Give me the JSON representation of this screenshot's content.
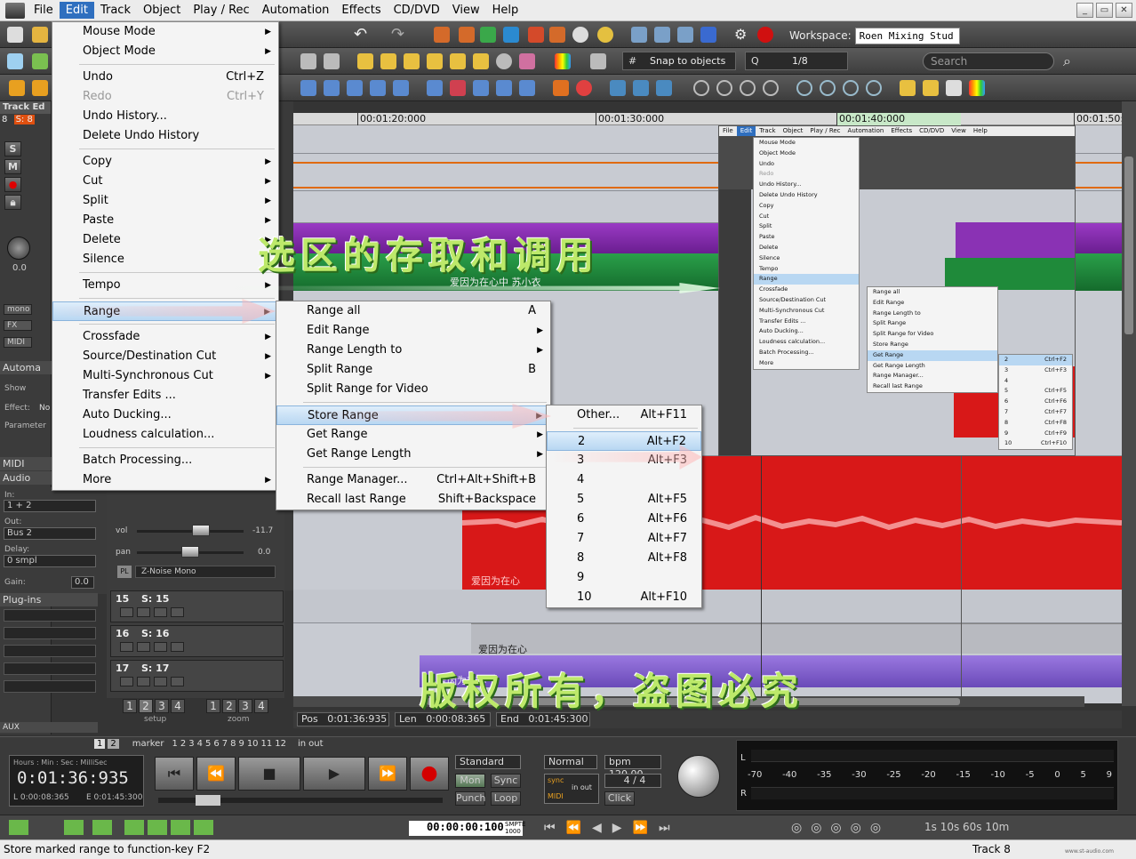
{
  "menubar": {
    "items": [
      "File",
      "Edit",
      "Track",
      "Object",
      "Play / Rec",
      "Automation",
      "Effects",
      "CD/DVD",
      "View",
      "Help"
    ],
    "active": "Edit"
  },
  "toolbar": {
    "workspace_label": "Workspace:",
    "workspace_value": "Roen Mixing Stud",
    "snap": "Snap to objects",
    "quantize": "1/8",
    "search_placeholder": "Search"
  },
  "left_panel": {
    "track_label": "Track Ed",
    "track_number": "8",
    "track_name": "S: 8",
    "pan_value": "0.0",
    "mono_label": "mono",
    "fx_label": "FX",
    "midi_label": "MIDI",
    "automation_header": "Automa",
    "show_label": "Show",
    "effect_label": "Effect:",
    "effect_value": "No",
    "parameter_label": "Parameter",
    "midi_header": "MIDI",
    "audio_header": "Audio",
    "in_label": "In:",
    "in_value": "1 + 2",
    "out_label": "Out:",
    "out_value": "Bus 2",
    "delay_label": "Delay:",
    "delay_value": "0 smpl",
    "gain_label": "Gain:",
    "gain_value": "0.0",
    "plugins_header": "Plug-ins",
    "aux_header": "AUX"
  },
  "edit_menu": {
    "items": [
      {
        "label": "Mouse Mode",
        "shortcut": "",
        "submenu": true
      },
      {
        "label": "Object Mode",
        "shortcut": "",
        "submenu": true
      },
      {
        "sep": true
      },
      {
        "label": "Undo",
        "shortcut": "Ctrl+Z"
      },
      {
        "label": "Redo",
        "shortcut": "Ctrl+Y",
        "disabled": true
      },
      {
        "label": "Undo History...",
        "shortcut": ""
      },
      {
        "label": "Delete Undo History",
        "shortcut": ""
      },
      {
        "sep": true
      },
      {
        "label": "Copy",
        "shortcut": "",
        "submenu": true
      },
      {
        "label": "Cut",
        "shortcut": "",
        "submenu": true
      },
      {
        "label": "Split",
        "shortcut": "",
        "submenu": true
      },
      {
        "label": "Paste",
        "shortcut": "",
        "submenu": true
      },
      {
        "label": "Delete",
        "shortcut": "",
        "submenu": true
      },
      {
        "label": "Silence",
        "shortcut": ""
      },
      {
        "sep": true
      },
      {
        "label": "Tempo",
        "shortcut": "",
        "submenu": true
      },
      {
        "sep": true
      },
      {
        "label": "Range",
        "shortcut": "",
        "submenu": true,
        "highlight": true
      },
      {
        "sep": true
      },
      {
        "label": "Crossfade",
        "shortcut": "",
        "submenu": true
      },
      {
        "label": "Source/Destination Cut",
        "shortcut": "",
        "submenu": true
      },
      {
        "label": "Multi-Synchronous Cut",
        "shortcut": "",
        "submenu": true
      },
      {
        "label": "Transfer Edits ...",
        "shortcut": ""
      },
      {
        "label": "Auto Ducking...",
        "shortcut": ""
      },
      {
        "label": "Loudness calculation...",
        "shortcut": ""
      },
      {
        "sep": true
      },
      {
        "label": "Batch Processing...",
        "shortcut": ""
      },
      {
        "label": "More",
        "shortcut": "",
        "submenu": true
      }
    ]
  },
  "range_menu": {
    "items": [
      {
        "label": "Range all",
        "shortcut": "A"
      },
      {
        "label": "Edit Range",
        "shortcut": "",
        "submenu": true
      },
      {
        "label": "Range Length to",
        "shortcut": "",
        "submenu": true
      },
      {
        "label": "Split Range",
        "shortcut": "B"
      },
      {
        "label": "Split Range for Video",
        "shortcut": ""
      },
      {
        "sep": true
      },
      {
        "label": "Store Range",
        "shortcut": "",
        "submenu": true,
        "highlight": true
      },
      {
        "label": "Get Range",
        "shortcut": "",
        "submenu": true
      },
      {
        "label": "Get Range Length",
        "shortcut": "",
        "submenu": true
      },
      {
        "sep": true
      },
      {
        "label": "Range Manager...",
        "shortcut": "Ctrl+Alt+Shift+B"
      },
      {
        "label": "Recall last Range",
        "shortcut": "Shift+Backspace"
      }
    ]
  },
  "store_menu": {
    "items": [
      {
        "label": "Other...",
        "shortcut": "Alt+F11"
      },
      {
        "sep": true
      },
      {
        "label": "2",
        "shortcut": "Alt+F2",
        "highlight": true
      },
      {
        "label": "3",
        "shortcut": "Alt+F3"
      },
      {
        "label": "4",
        "shortcut": ""
      },
      {
        "label": "5",
        "shortcut": "Alt+F5"
      },
      {
        "label": "6",
        "shortcut": "Alt+F6"
      },
      {
        "label": "7",
        "shortcut": "Alt+F7"
      },
      {
        "label": "8",
        "shortcut": "Alt+F8"
      },
      {
        "label": "9",
        "shortcut": ""
      },
      {
        "label": "10",
        "shortcut": "Alt+F10"
      }
    ]
  },
  "ruler": {
    "ticks": [
      "00:01:20:000",
      "00:01:30:000",
      "00:01:40:000",
      "00:01:50:"
    ]
  },
  "clips": {
    "clip1": "爱因为在心中 苏小衣",
    "clip2": "爱因为在心",
    "clip3": "爱因为在心",
    "clip4": "爱因为在心"
  },
  "tracks": [
    {
      "num": "15",
      "name": "S: 15"
    },
    {
      "num": "16",
      "name": "S: 16"
    },
    {
      "num": "17",
      "name": "S: 17"
    }
  ],
  "mixer_strip": {
    "vol_label": "vol",
    "vol_value": "-11.7",
    "pan_label": "pan",
    "pan_value": "0.0",
    "plugin_badge": "PL",
    "plugin": "Z-Noise Mono"
  },
  "zoom": {
    "setup_label": "setup",
    "zoom_label": "zoom",
    "setup_buttons": [
      "1",
      "2",
      "3",
      "4"
    ],
    "zoom_buttons": [
      "1",
      "2",
      "3",
      "4"
    ]
  },
  "position": {
    "pos_label": "Pos",
    "pos_value": "0:01:36:935",
    "len_label": "Len",
    "len_value": "0:00:08:365",
    "end_label": "End",
    "end_value": "0:01:45:300"
  },
  "transport": {
    "time_label": "Hours : Min : Sec : MilliSec",
    "time_value": "0:01:36:935",
    "l_value": "L 0:00:08:365",
    "e_value": "E 0:01:45:300",
    "mode": "Standard",
    "normal": "Normal",
    "bpm": "bpm 120.00",
    "sig": "4 / 4",
    "mon": "Mon",
    "sync": "Sync",
    "punch": "Punch",
    "loop": "Loop",
    "click": "Click",
    "marker_label": "marker",
    "in_label": "in",
    "out_label": "out",
    "marker_numbers": [
      "1",
      "2",
      "3",
      "4",
      "5",
      "6",
      "7",
      "8",
      "9",
      "10",
      "11",
      "12"
    ],
    "sync_label": "sync",
    "midi_label": "MIDI",
    "in_out_label": "in out",
    "counter_value": "00:00:00:100",
    "counter_unit": "SMPTE 1000"
  },
  "meter_scale": [
    "-70",
    "-40",
    "-35",
    "-30",
    "-25",
    "-20",
    "-15",
    "-10",
    "-5",
    "0",
    "5",
    "9"
  ],
  "meter_channels": [
    "L",
    "R"
  ],
  "zoom_levels": "1s 10s 60s 10m",
  "status": {
    "text": "Store marked range to function-key F2",
    "track": "Track 8"
  },
  "watermark": {
    "title": "选区的存取和调用",
    "copyright": "版权所有，盗图必究",
    "site": "www.st-audio.com"
  },
  "inset": {
    "menubar": [
      "File",
      "Edit",
      "Track",
      "Object",
      "Play / Rec",
      "Automation",
      "Effects",
      "CD/DVD",
      "View",
      "Help"
    ],
    "edit_items": [
      "Mouse Mode",
      "Object Mode",
      "Undo",
      "Redo",
      "Undo History...",
      "Delete Undo History",
      "Copy",
      "Cut",
      "Split",
      "Paste",
      "Delete",
      "Silence",
      "Tempo",
      "Range",
      "Crossfade",
      "Source/Destination Cut",
      "Multi-Synchronous Cut",
      "Transfer Edits ...",
      "Auto Ducking...",
      "Loudness calculation...",
      "Batch Processing...",
      "More"
    ],
    "range_items": [
      "Range all",
      "Edit Range",
      "Range Length to",
      "Split Range",
      "Split Range for Video",
      "Store Range",
      "Get Range",
      "Get Range Length",
      "Range Manager...",
      "Recall last Range"
    ],
    "get_items": [
      [
        "2",
        "Ctrl+F2"
      ],
      [
        "3",
        "Ctrl+F3"
      ],
      [
        "4",
        ""
      ],
      [
        "5",
        "Ctrl+F5"
      ],
      [
        "6",
        "Ctrl+F6"
      ],
      [
        "7",
        "Ctrl+F7"
      ],
      [
        "8",
        "Ctrl+F8"
      ],
      [
        "9",
        "Ctrl+F9"
      ],
      [
        "10",
        "Ctrl+F10"
      ]
    ]
  },
  "colors": {
    "menu_highlight": "#b8d7f2",
    "clip_red": "#d81818",
    "clip_purple": "#8a32b4",
    "clip_green": "#1f8a3a"
  }
}
